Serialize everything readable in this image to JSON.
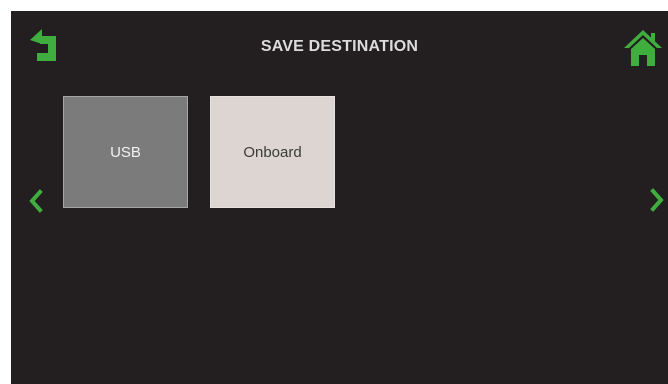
{
  "header": {
    "title": "SAVE DESTINATION",
    "back_icon": "back-arrow-icon",
    "home_icon": "home-icon"
  },
  "destinations": [
    {
      "label": "USB",
      "selected": true
    },
    {
      "label": "Onboard",
      "selected": false
    }
  ],
  "navigation": {
    "prev_icon": "chevron-left-icon",
    "next_icon": "chevron-right-icon"
  },
  "colors": {
    "background": "#231f20",
    "accent_green": "#3fae3f",
    "tile_selected": "#7b7b7b",
    "tile_default": "#dcd5d1",
    "title_text": "#dcdcdc"
  }
}
